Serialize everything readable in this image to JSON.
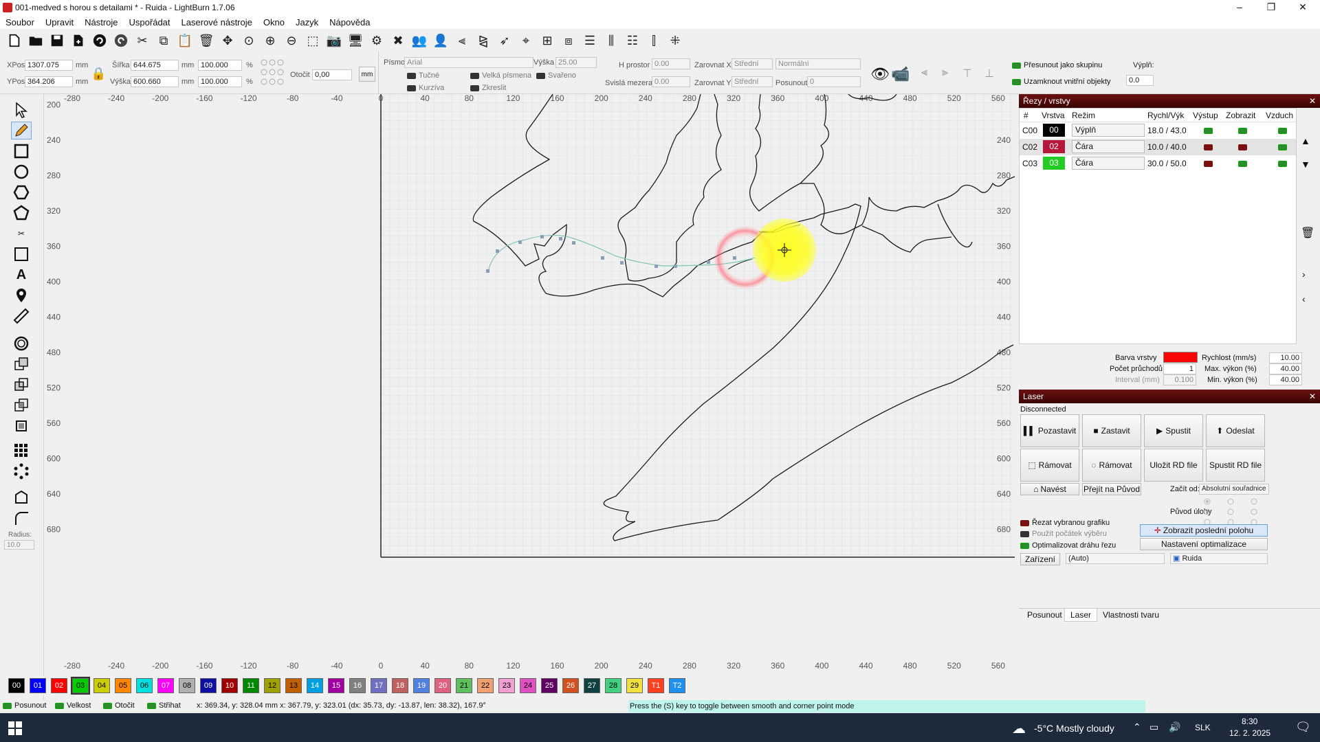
{
  "window": {
    "title": "001-medved s horou s detailami * - Ruida - LightBurn 1.7.06",
    "controls": [
      "–",
      "❐",
      "✕"
    ]
  },
  "menu": [
    "Soubor",
    "Upravit",
    "Nástroje",
    "Uspořádat",
    "Laserové nástroje",
    "Okno",
    "Jazyk",
    "Nápověda"
  ],
  "props": {
    "xpos_label": "XPos",
    "xpos": "1307.075",
    "ypos_label": "YPos",
    "ypos": "364.206",
    "unit": "mm",
    "width_label": "Šířka",
    "width": "644.675",
    "height_label": "Výška",
    "height": "600.660",
    "scale_w": "100.000",
    "scale_h": "100.000",
    "pct": "%",
    "rotate_label": "Otočit",
    "rotate": "0,00",
    "mm_button": "mm",
    "font_label": "Písmo",
    "font": "Arial",
    "fheight_label": "Výška",
    "fheight": "25.00",
    "bold": "Tučné",
    "italic": "Kurzíva",
    "caps": "Velká písmena",
    "welded": "Svařeno",
    "distort": "Zkreslit",
    "hspace_label": "H prostor",
    "hspace": "0.00",
    "vspace_label": "Svislá mezera",
    "vspace": "0.00",
    "alignx_label": "Zarovnat X",
    "alignx": "Střední",
    "aligny_label": "Zarovnat Y",
    "aligny": "Střední",
    "mode_value": "Normální",
    "offset_label": "Posunout",
    "offset": "0",
    "move_group": "Přesunout jako skupinu",
    "lock_inner": "Uzamknout vnitřní objekty",
    "fill_label": "Výplň:",
    "fill": "0.0"
  },
  "ruler": {
    "x": [
      "-280",
      "-240",
      "-200",
      "-160",
      "-120",
      "-80",
      "-40",
      "0",
      "40",
      "80",
      "120",
      "160",
      "200",
      "240",
      "280",
      "320",
      "360",
      "400",
      "440",
      "480",
      "520",
      "560"
    ],
    "y": [
      "200",
      "240",
      "280",
      "320",
      "360",
      "400",
      "440",
      "480",
      "520",
      "560",
      "600",
      "640",
      "680"
    ],
    "yright": [
      "240",
      "280",
      "320",
      "360",
      "400",
      "440",
      "480",
      "520",
      "560",
      "600",
      "640",
      "680"
    ]
  },
  "layers": {
    "title": "Řezy / vrstvy",
    "headers": [
      "#",
      "Vrstva",
      "Režim",
      "Rychl/Výk",
      "Výstup",
      "Zobrazit",
      "Vzduch"
    ],
    "rows": [
      {
        "id": "C00",
        "num": "00",
        "color": "#000000",
        "mode": "Výplň",
        "speed": "18.0 / 43.0",
        "out": "g"
      },
      {
        "id": "C02",
        "num": "02",
        "color": "#b5163a",
        "mode": "Čára",
        "speed": "10.0 / 40.0",
        "out": "r"
      },
      {
        "id": "C03",
        "num": "03",
        "color": "#22cc22",
        "mode": "Čára",
        "speed": "30.0 / 50.0",
        "out": "r"
      }
    ],
    "layer_color_label": "Barva vrstvy",
    "speed_label": "Rychlost (mm/s)",
    "speed": "10.00",
    "passes_label": "Počet průchodů",
    "passes": "1",
    "maxp_label": "Max. výkon (%)",
    "maxp": "40.00",
    "interval_label": "Interval (mm)",
    "interval": "0.100",
    "minp_label": "Min. výkon (%)",
    "minp": "40.00"
  },
  "laser": {
    "title": "Laser",
    "status": "Disconnected",
    "pause": "Pozastavit",
    "stop": "Zastavit",
    "start": "Spustit",
    "send": "Odeslat",
    "frame1": "Rámovat",
    "frame2": "Rámovat",
    "save_rd": "Uložit RD file",
    "run_rd": "Spustit RD file",
    "home": "Navést",
    "go_origin": "Přejít na Původ",
    "start_from_label": "Začít od:",
    "start_from": "Absolutní souřadnice",
    "job_origin": "Původ úlohy",
    "cut_selected": "Řezat vybranou grafiku",
    "use_origin": "Použít počátek výběru",
    "optimize": "Optimalizovat dráhu řezu",
    "show_last": "Zobrazit poslední polohu",
    "opt_settings": "Nastavení optimalizace",
    "devices": "Zařízení",
    "port": "(Auto)",
    "device": "Ruida"
  },
  "tabs": [
    "Posunout",
    "Laser",
    "Vlastnosti tvaru"
  ],
  "palette": [
    {
      "l": "00",
      "c": "#000000",
      "t": "#fff"
    },
    {
      "l": "01",
      "c": "#0000ff",
      "t": "#fff"
    },
    {
      "l": "02",
      "c": "#ff0000",
      "t": "#fff"
    },
    {
      "l": "03",
      "c": "#00cc00",
      "t": "#000"
    },
    {
      "l": "04",
      "c": "#cccc00",
      "t": "#000"
    },
    {
      "l": "05",
      "c": "#ff8800",
      "t": "#000"
    },
    {
      "l": "06",
      "c": "#00e0e0",
      "t": "#000"
    },
    {
      "l": "07",
      "c": "#ff00ff",
      "t": "#fff"
    },
    {
      "l": "08",
      "c": "#b0b0b0",
      "t": "#000"
    },
    {
      "l": "09",
      "c": "#1010a0",
      "t": "#fff"
    },
    {
      "l": "10",
      "c": "#a00000",
      "t": "#fff"
    },
    {
      "l": "11",
      "c": "#008800",
      "t": "#fff"
    },
    {
      "l": "12",
      "c": "#a0a000",
      "t": "#000"
    },
    {
      "l": "13",
      "c": "#c06000",
      "t": "#000"
    },
    {
      "l": "14",
      "c": "#00a0e0",
      "t": "#fff"
    },
    {
      "l": "15",
      "c": "#a000a0",
      "t": "#fff"
    },
    {
      "l": "16",
      "c": "#808080",
      "t": "#fff"
    },
    {
      "l": "17",
      "c": "#7070c0",
      "t": "#fff"
    },
    {
      "l": "18",
      "c": "#c06060",
      "t": "#fff"
    },
    {
      "l": "19",
      "c": "#5080e0",
      "t": "#fff"
    },
    {
      "l": "20",
      "c": "#e06080",
      "t": "#fff"
    },
    {
      "l": "21",
      "c": "#60c060",
      "t": "#000"
    },
    {
      "l": "22",
      "c": "#f0a070",
      "t": "#000"
    },
    {
      "l": "23",
      "c": "#f0a0d0",
      "t": "#000"
    },
    {
      "l": "24",
      "c": "#e050c0",
      "t": "#000"
    },
    {
      "l": "25",
      "c": "#600060",
      "t": "#fff"
    },
    {
      "l": "26",
      "c": "#d05020",
      "t": "#fff"
    },
    {
      "l": "27",
      "c": "#104040",
      "t": "#fff"
    },
    {
      "l": "28",
      "c": "#40d080",
      "t": "#000"
    },
    {
      "l": "29",
      "c": "#f0e040",
      "t": "#000"
    },
    {
      "l": "T1",
      "c": "#ff4020",
      "t": "#fff"
    },
    {
      "l": "T2",
      "c": "#2090f0",
      "t": "#fff"
    }
  ],
  "status": {
    "move": "Posunout",
    "size": "Velkost",
    "rotate": "Otočit",
    "shear": "Střihat",
    "coords": "x: 369.34, y: 328.04 mm  x: 367.79, y: 323.01  (dx: 35.73, dy: -13.87, len: 38.32), 167.9°",
    "hint": "Press the (S) key to toggle between smooth and corner point mode"
  },
  "taskbar": {
    "weather": "-5°C  Mostly cloudy",
    "lang": "SLK",
    "time": "8:30",
    "date": "12. 2. 2025"
  },
  "radius": {
    "label": "Radius:",
    "value": "10.0"
  }
}
